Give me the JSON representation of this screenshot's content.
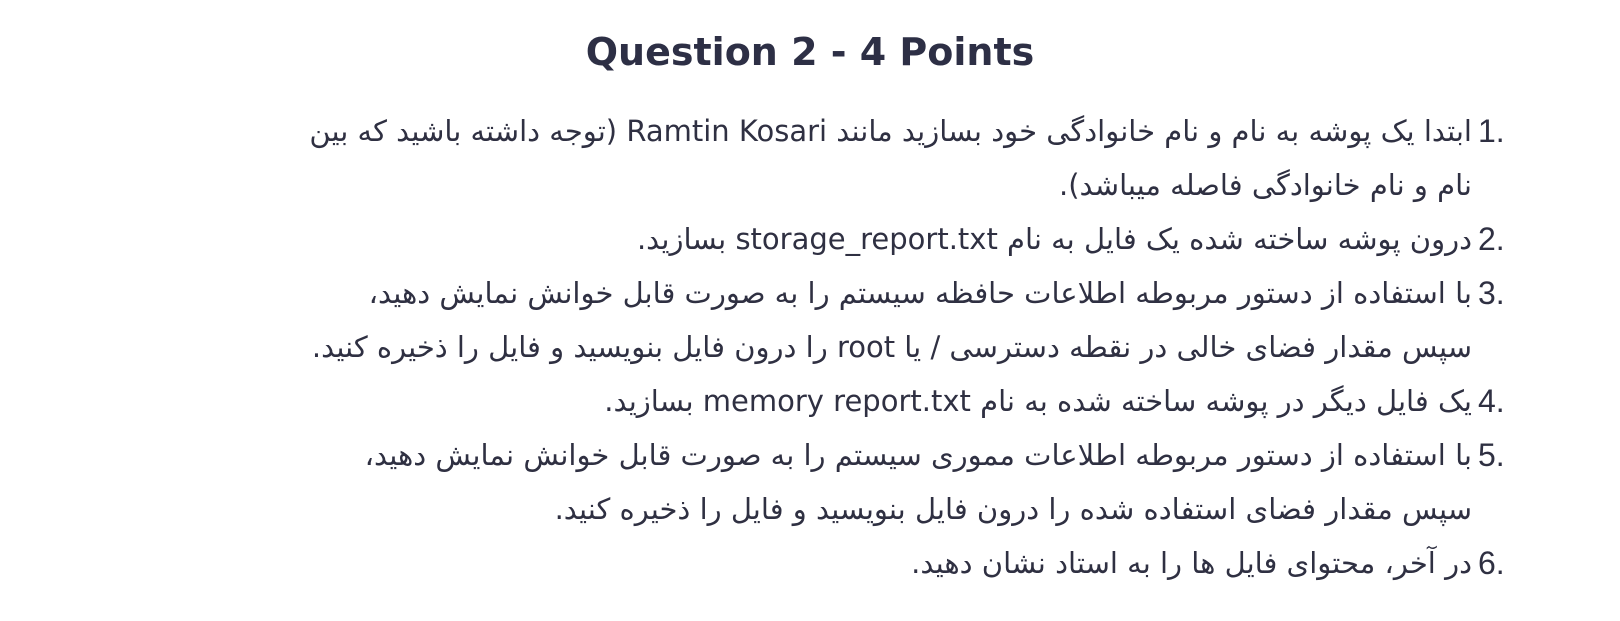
{
  "title": "Question 2 - 4 Points",
  "items": [
    {
      "number": "1.",
      "lines": [
        "ابتدا یک پوشه به نام و نام خانوادگی خود بسازید مانند Ramtin Kosari (توجه داشته باشید که بین",
        "نام و نام خانوادگی فاصله میباشد)."
      ]
    },
    {
      "number": "2.",
      "lines": [
        "درون پوشه ساخته شده یک فایل به نام storage_report.txt بسازید."
      ]
    },
    {
      "number": "3.",
      "lines": [
        "با استفاده از دستور مربوطه اطلاعات حافظه سیستم را به صورت قابل خوانش نمایش دهید،",
        "سپس مقدار فضای خالی در نقطه دسترسی / یا root را درون فایل بنویسید و فایل را ذخیره کنید."
      ]
    },
    {
      "number": "4.",
      "lines": [
        "یک فایل دیگر در پوشه ساخته شده به نام memory report.txt بسازید."
      ]
    },
    {
      "number": "5.",
      "lines": [
        "با استفاده از دستور مربوطه اطلاعات مموری سیستم را به صورت قابل خوانش نمایش دهید،",
        "سپس مقدار فضای استفاده شده را درون فایل بنویسید و فایل را ذخیره کنید."
      ]
    },
    {
      "number": "6.",
      "lines": [
        "در آخر، محتوای فایل ها را به استاد نشان دهید."
      ]
    }
  ]
}
